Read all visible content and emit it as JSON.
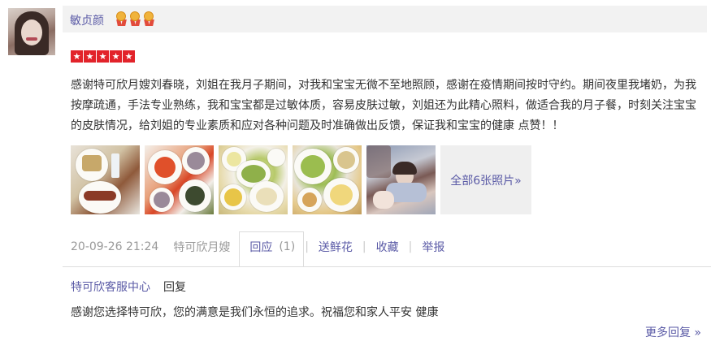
{
  "user": {
    "name": "敏贞颜",
    "medal_icons": [
      "medal-icon",
      "medal-icon",
      "medal-icon"
    ]
  },
  "rating": {
    "stars": 5,
    "star_icon": "star-icon",
    "star_color": "#e2232a"
  },
  "review": {
    "text": "感谢特可欣月嫂刘春晓，刘姐在我月子期间，对我和宝宝无微不至地照顾，感谢在疫情期间按时守约。期间夜里我堵奶，为我按摩疏通，手法专业熟练，我和宝宝都是过敏体质，容易皮肤过敏，刘姐还为此精心照料，做适合我的月子餐，时刻关注宝宝的皮肤情况，给刘姐的专业素质和应对各种问题及时准确做出反馈，保证我和宝宝的健康 点赞！！"
  },
  "photos": {
    "more_label": "全部6张照片»"
  },
  "meta": {
    "date": "20-09-26 21:24",
    "source": "特可欣月嫂",
    "reply_label": "回应",
    "reply_count": "(1)",
    "flower_label": "送鲜花",
    "favorite_label": "收藏",
    "report_label": "举报"
  },
  "reply": {
    "author": "特可欣客服中心",
    "verb": "回复",
    "text": "感谢您选择特可欣，您的满意是我们永恒的追求。祝福您和家人平安 健康",
    "more_label": "更多回复 »"
  },
  "colors": {
    "link": "#5a5aa6",
    "meta_gray": "#999999",
    "name_bar_bg": "#f2f2f2"
  }
}
